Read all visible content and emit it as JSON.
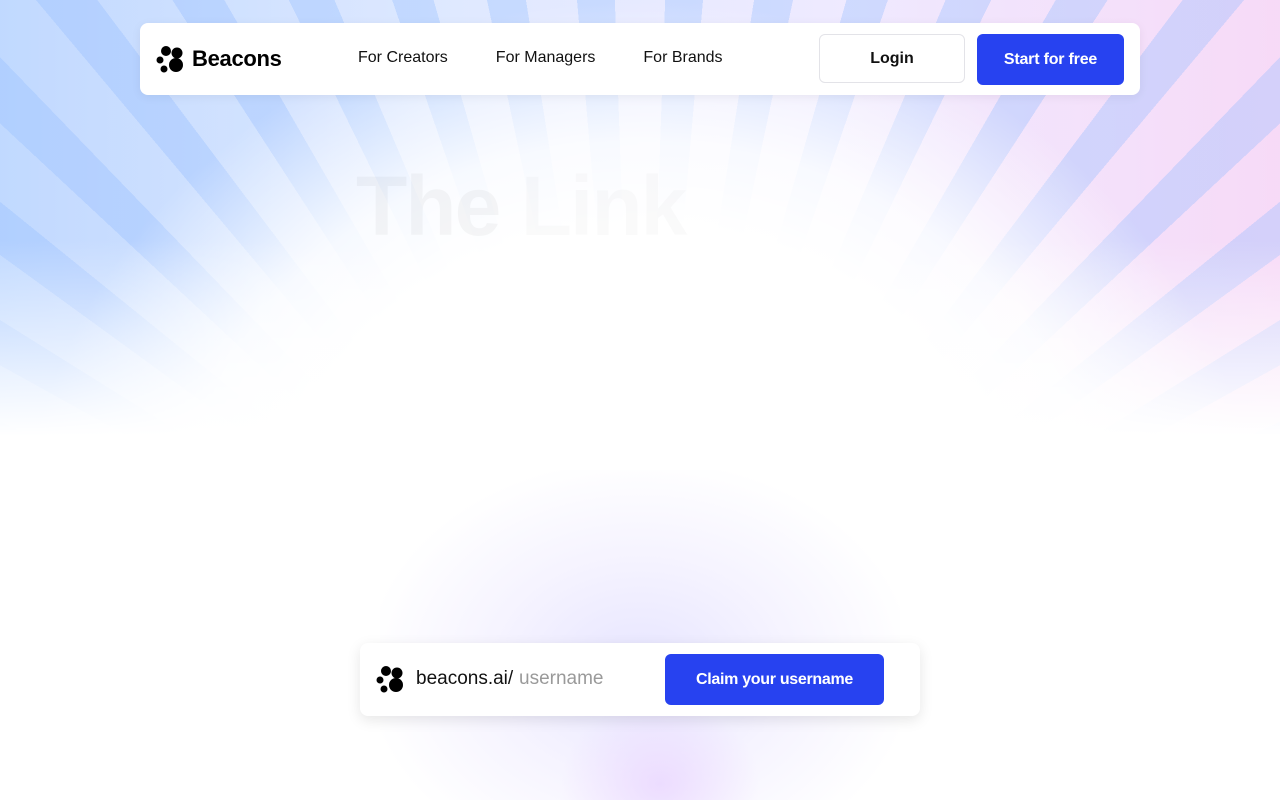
{
  "brand": {
    "name": "Beacons",
    "logo_icon": "beacons-dots-icon",
    "accent_color": "#2742f0"
  },
  "nav": {
    "links": [
      {
        "label": "For Creators"
      },
      {
        "label": "For Managers"
      },
      {
        "label": "For Brands"
      }
    ],
    "login_label": "Login",
    "start_label": "Start for free"
  },
  "hero": {
    "headline_word1": "The",
    "headline_word2": "Link"
  },
  "claim": {
    "prefix": "beacons.ai/",
    "placeholder": "username",
    "button_label": "Claim your username"
  }
}
